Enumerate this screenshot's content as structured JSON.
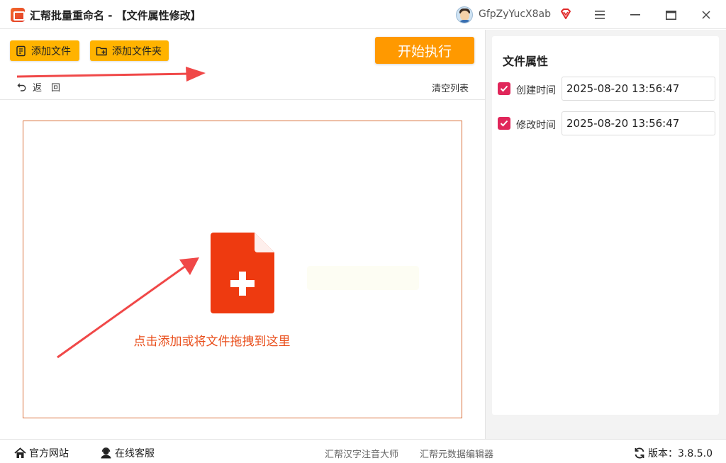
{
  "window": {
    "title": "汇帮批量重命名 - 【文件属性修改】",
    "username": "GfpZyYucX8ab"
  },
  "toolbar": {
    "add_file": "添加文件",
    "add_folder": "添加文件夹",
    "start": "开始执行",
    "back": "返回",
    "clear_list": "清空列表"
  },
  "drop_zone": {
    "hint": "点击添加或将文件拖拽到这里"
  },
  "properties": {
    "title": "文件属性",
    "create_time": {
      "label": "创建时间",
      "value": "2025-08-20 13:56:47",
      "checked": true
    },
    "modify_time": {
      "label": "修改时间",
      "value": "2025-08-20 13:56:47",
      "checked": true
    }
  },
  "statusbar": {
    "official_site": "官方网站",
    "online_service": "在线客服",
    "pinyin_tool": "汇帮汉字注音大师",
    "metadata_tool": "汇帮元数据编辑器",
    "version": "版本：3.8.5.0"
  },
  "colors": {
    "accent_yellow": "#ffb300",
    "start_orange": "#ff9900",
    "file_icon_red": "#ee3a10",
    "checkbox_pink": "#e0265a",
    "arrow_red": "#f04848"
  }
}
